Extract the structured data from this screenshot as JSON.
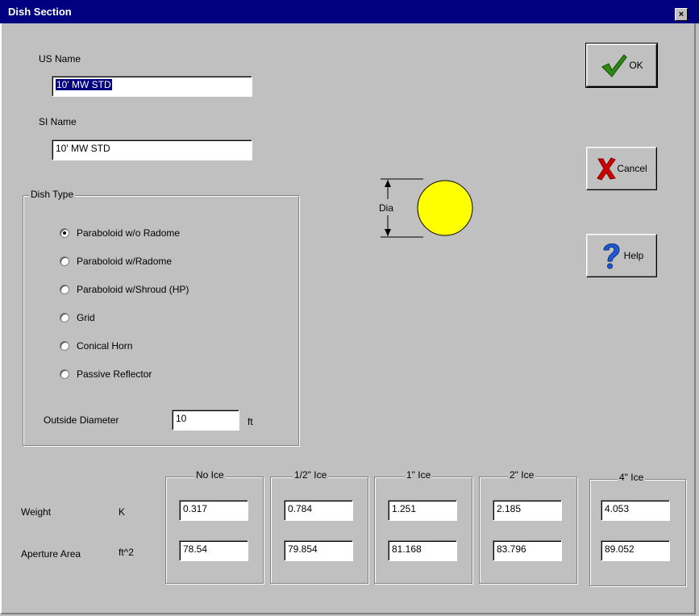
{
  "window": {
    "title": "Dish Section",
    "close_label": "×"
  },
  "us_name": {
    "label": "US Name",
    "value": "10' MW STD"
  },
  "si_name": {
    "label": "SI Name",
    "value": "10' MW STD"
  },
  "dish_type": {
    "legend": "Dish Type",
    "options": [
      "Paraboloid w/o Radome",
      "Paraboloid w/Radome",
      "Paraboloid w/Shroud (HP)",
      "Grid",
      "Conical Horn",
      "Passive Reflector"
    ],
    "selected": "Paraboloid w/o Radome",
    "outside_diameter": {
      "label": "Outside Diameter",
      "value": "10",
      "unit": "ft"
    }
  },
  "diagram": {
    "dim_label": "Dia",
    "circle_color": "#ffff00"
  },
  "buttons": {
    "ok": "OK",
    "cancel": "Cancel",
    "help": "Help"
  },
  "ice_table": {
    "rows": [
      {
        "label": "Weight",
        "unit": "K"
      },
      {
        "label": "Aperture Area",
        "unit": "ft^2"
      }
    ],
    "columns": [
      {
        "header": "No Ice",
        "weight": "0.317",
        "area": "78.54"
      },
      {
        "header": "1/2\" Ice",
        "weight": "0.784",
        "area": "79.854"
      },
      {
        "header": "1\" Ice",
        "weight": "1.251",
        "area": "81.168"
      },
      {
        "header": "2\" Ice",
        "weight": "2.185",
        "area": "83.796"
      },
      {
        "header": "4\" Ice",
        "weight": "4.053",
        "area": "89.052"
      }
    ]
  }
}
